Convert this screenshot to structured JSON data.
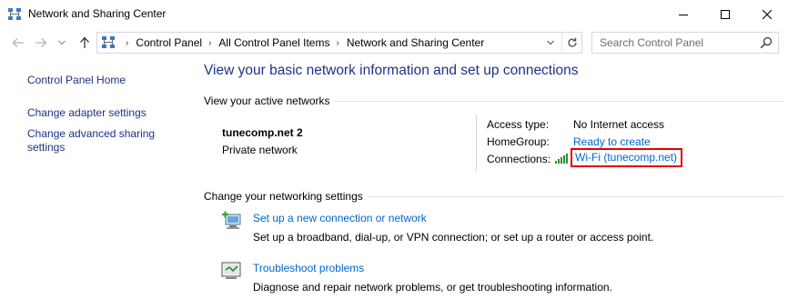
{
  "window": {
    "title": "Network and Sharing Center",
    "icon": "network-center-icon"
  },
  "nav": {
    "back": "back-arrow-icon",
    "forward": "forward-arrow-icon",
    "recent": "chevron-down-icon",
    "up": "up-arrow-icon"
  },
  "address": {
    "crumbs": [
      "Control Panel",
      "All Control Panel Items",
      "Network and Sharing Center"
    ]
  },
  "search": {
    "placeholder": "Search Control Panel"
  },
  "sidebar": {
    "items": [
      {
        "label": "Control Panel Home"
      },
      {
        "label": "Change adapter settings"
      },
      {
        "label": "Change advanced sharing"
      },
      {
        "label": "settings"
      }
    ]
  },
  "main": {
    "heading": "View your basic network information and set up connections",
    "active_networks_label": "View your active networks",
    "network": {
      "name": "tunecomp.net  2",
      "type": "Private network",
      "access_type_label": "Access type:",
      "access_type_value": "No Internet access",
      "homegroup_label": "HomeGroup:",
      "homegroup_value": "Ready to create",
      "connections_label": "Connections:",
      "connections_value": "Wi-Fi (tunecomp.net)"
    },
    "change_settings_label": "Change your networking settings",
    "tasks": [
      {
        "link": "Set up a new connection or network",
        "desc": "Set up a broadband, dial-up, or VPN connection; or set up a router or access point."
      },
      {
        "link": "Troubleshoot problems",
        "desc": "Diagnose and repair network problems, or get troubleshooting information."
      }
    ]
  },
  "colors": {
    "link": "#0066cc",
    "heading": "#1e3287",
    "highlight_border": "#e10000"
  }
}
